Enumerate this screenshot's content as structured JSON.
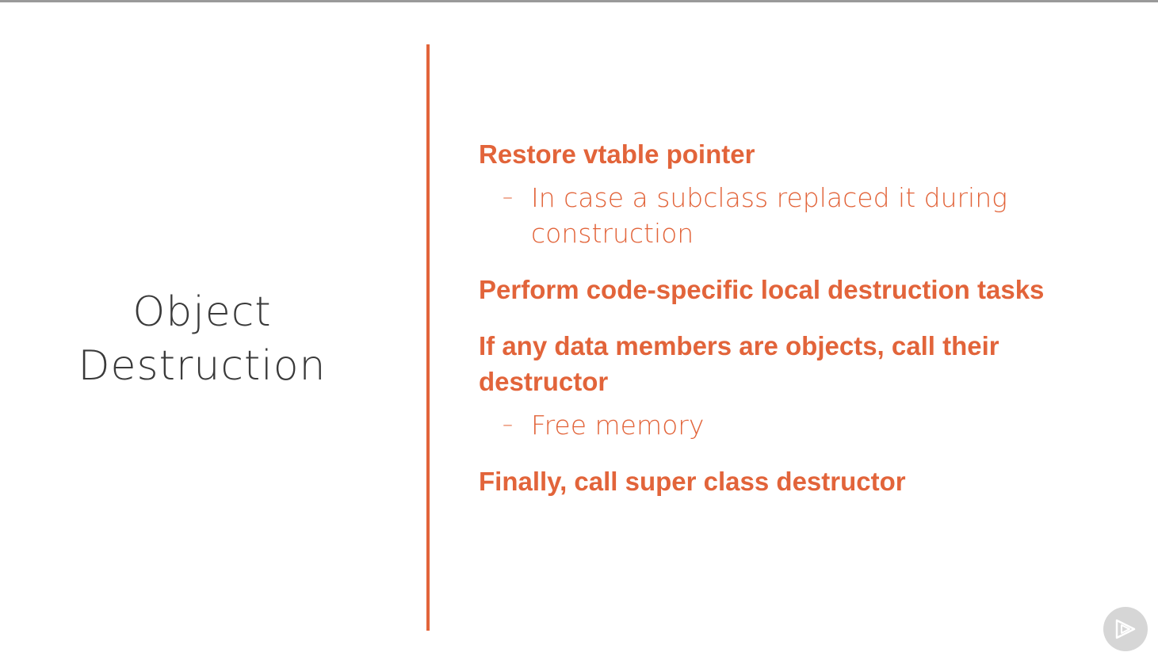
{
  "slide": {
    "title_lines": [
      "Object",
      "Destruction"
    ],
    "points": [
      {
        "text": "Restore vtable pointer",
        "sub": [
          "In case a subclass replaced it during construction"
        ]
      },
      {
        "text": "Perform code-specific local destruction tasks",
        "sub": []
      },
      {
        "text": "If any data members are objects, call their destructor",
        "sub": [
          "Free memory"
        ]
      },
      {
        "text": "Finally, call super class destructor",
        "sub": []
      }
    ],
    "sub_bullet_symbol": "–"
  },
  "badge": {
    "icon": "play-icon"
  },
  "colors": {
    "accent": "#e2643a",
    "title": "#3a3a3a",
    "top_rule": "#9a9a9a"
  }
}
